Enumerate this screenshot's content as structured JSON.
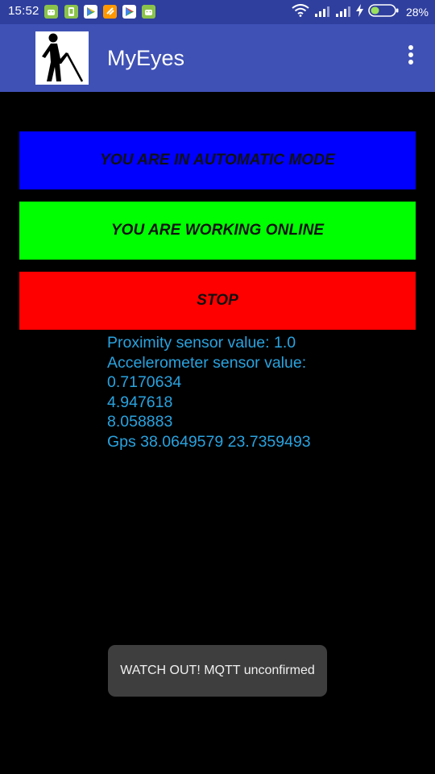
{
  "status_bar": {
    "time": "15:52",
    "battery_percent": "28%",
    "notification_icons": [
      "android-icon",
      "android-icon",
      "play-store-icon",
      "download-icon",
      "play-store-icon",
      "android-icon"
    ]
  },
  "app_bar": {
    "title": "MyEyes",
    "logo_icon": "blind-person-with-cane-icon",
    "menu_icon": "overflow-menu-icon"
  },
  "buttons": {
    "auto_mode": "YOU ARE IN AUTOMATIC MODE",
    "online": "YOU ARE WORKING ONLINE",
    "stop": "STOP"
  },
  "sensors": {
    "proximity": "Proximity sensor value: 1.0",
    "accelerometer_label": "Accelerometer sensor value:",
    "accel_x": "0.7170634",
    "accel_y": "4.947618",
    "accel_z": "8.058883",
    "gps": "Gps 38.0649579 23.7359493"
  },
  "toast": {
    "message": "WATCH OUT! MQTT unconfirmed"
  },
  "colors": {
    "status_bar": "#2f3f9e",
    "app_bar": "#3f51b5",
    "auto_button": "#0000ff",
    "online_button": "#00ff00",
    "stop_button": "#ff0000",
    "sensor_text": "#29a3df",
    "background": "#000000"
  }
}
